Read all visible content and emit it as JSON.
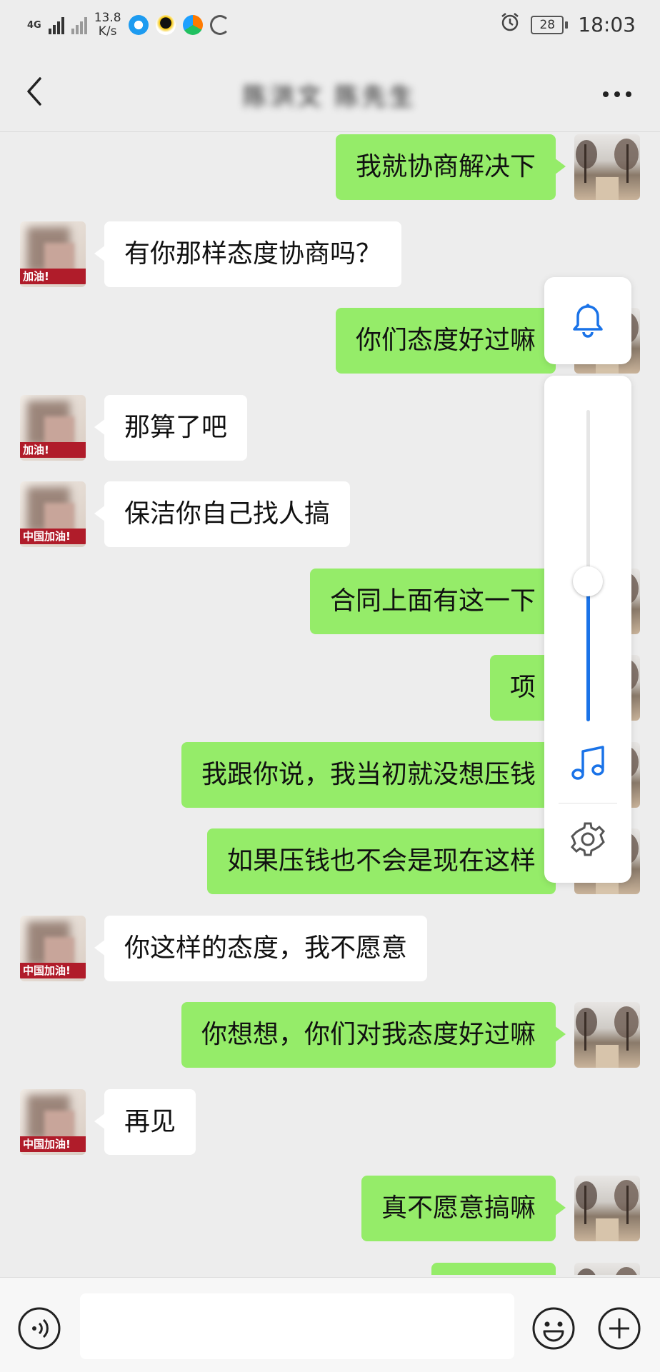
{
  "status_bar": {
    "network_type": "4G",
    "net_speed_value": "13.8",
    "net_speed_unit": "K/s",
    "battery_level": "28",
    "time": "18:03"
  },
  "title_bar": {
    "title": "陈洪文 陈先生"
  },
  "messages": [
    {
      "sender": "me",
      "text": "我就协商解决下"
    },
    {
      "sender": "them",
      "text": "有你那样态度协商吗？",
      "avatar_badge": "加油!"
    },
    {
      "sender": "me",
      "text": "你们态度好过嘛"
    },
    {
      "sender": "them",
      "text": "那算了吧",
      "avatar_badge": "加油!"
    },
    {
      "sender": "them",
      "text": "保洁你自己找人搞",
      "avatar_badge": "中国加油!"
    },
    {
      "sender": "me",
      "text": "合同上面有这一下"
    },
    {
      "sender": "me",
      "text": "项"
    },
    {
      "sender": "me",
      "text": "我跟你说，我当初就没想压钱"
    },
    {
      "sender": "me",
      "text": "如果压钱也不会是现在这样"
    },
    {
      "sender": "them",
      "text": "你这样的态度，我不愿意",
      "avatar_badge": "中国加油!"
    },
    {
      "sender": "me",
      "text": "你想想，你们对我态度好过嘛"
    },
    {
      "sender": "them",
      "text": "再见",
      "avatar_badge": "中国加油!"
    },
    {
      "sender": "me",
      "text": "真不愿意搞嘛"
    }
  ],
  "volume_panel": {
    "ringer_icon": "bell-icon",
    "media_icon": "music-note-icon",
    "settings_icon": "gear-icon",
    "level": 0.45,
    "accent_color": "#1a73e8"
  },
  "input_bar": {
    "voice_icon": "voice-icon",
    "emoji_icon": "emoji-icon",
    "plus_icon": "plus-icon",
    "input_value": ""
  },
  "colors": {
    "my_bubble": "#95ec69",
    "their_bubble": "#ffffff",
    "background": "#ededed"
  }
}
